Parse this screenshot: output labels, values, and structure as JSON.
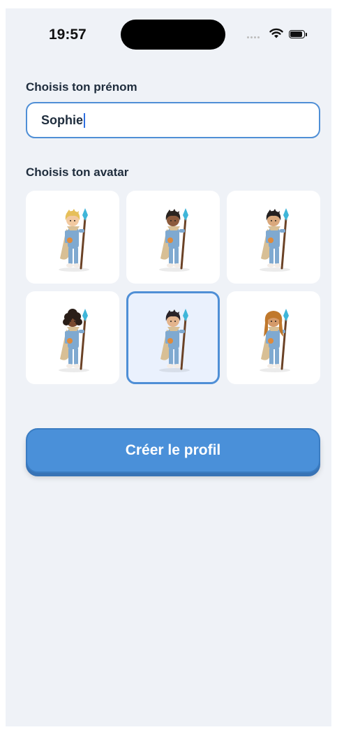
{
  "status_bar": {
    "time": "19:57"
  },
  "name_section": {
    "label": "Choisis ton prénom",
    "value": "Sophie"
  },
  "avatar_section": {
    "label": "Choisis ton avatar",
    "selected_index": 4,
    "avatars": [
      {
        "hair": "#e6bf59",
        "skin": "#f2c9a0",
        "style": "short"
      },
      {
        "hair": "#2a2420",
        "skin": "#8b5a3c",
        "style": "short"
      },
      {
        "hair": "#242020",
        "skin": "#d9a87c",
        "style": "short"
      },
      {
        "hair": "#2a1e18",
        "skin": "#7a4a30",
        "style": "curly"
      },
      {
        "hair": "#2a2428",
        "skin": "#e3b48d",
        "style": "short"
      },
      {
        "hair": "#c0782c",
        "skin": "#d49a6a",
        "style": "long"
      }
    ]
  },
  "create_button": {
    "label": "Créer le profil"
  },
  "colors": {
    "accent": "#4a90d9",
    "background": "#eff2f7",
    "outfit": "#7fa9d0",
    "cape": "#d8bf95"
  }
}
